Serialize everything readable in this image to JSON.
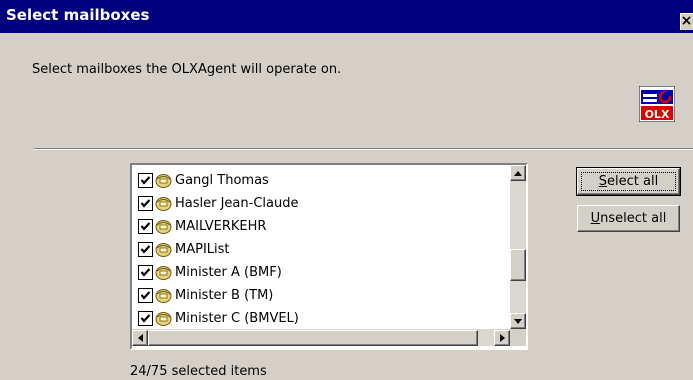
{
  "window": {
    "title": "Select mailboxes",
    "close_glyph": "×"
  },
  "prompt": "Select mailboxes the OLXAgent will operate on.",
  "logo": {
    "text": "OLX",
    "icon": "olx-logo-icon",
    "accent": "#e00000"
  },
  "mailboxes": [
    {
      "label": "Gangl Thomas",
      "checked": true
    },
    {
      "label": "Hasler Jean-Claude",
      "checked": true
    },
    {
      "label": "MAILVERKEHR",
      "checked": true
    },
    {
      "label": "MAPIList",
      "checked": true
    },
    {
      "label": "Minister A (BMF)",
      "checked": true
    },
    {
      "label": "Minister B (TM)",
      "checked": true
    },
    {
      "label": "Minister C (BMVEL)",
      "checked": true
    }
  ],
  "buttons": {
    "select_all": {
      "mnemonic": "S",
      "rest": "elect all"
    },
    "unselect_all": {
      "mnemonic": "U",
      "rest": "nselect all"
    }
  },
  "status": "24/75 selected items",
  "colors": {
    "titlebar": "#00007f",
    "dialog_bg": "#d4d0c8",
    "list_bg": "#ffffff"
  }
}
